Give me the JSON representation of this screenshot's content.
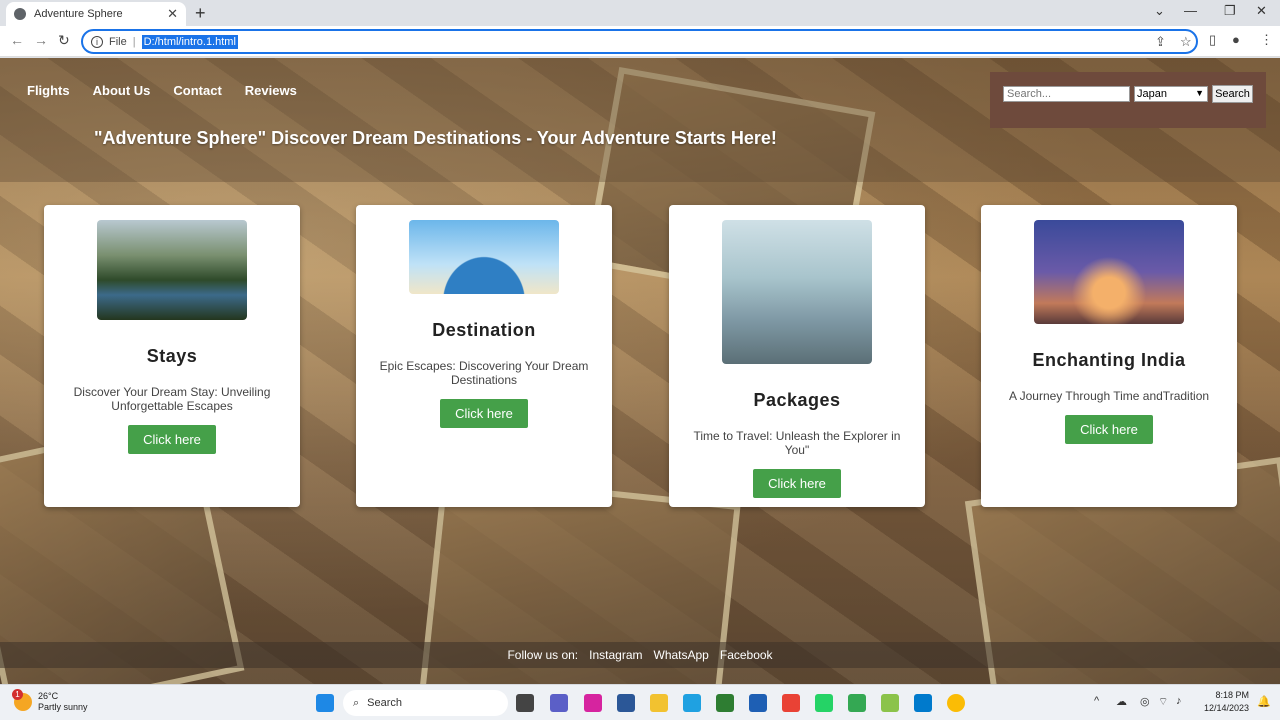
{
  "browser": {
    "tab_title": "Adventure Sphere",
    "new_tab": "+",
    "address_scheme": "File",
    "address_url": "D:/html/intro.1.html"
  },
  "page": {
    "nav": [
      "Flights",
      "About Us",
      "Contact",
      "Reviews"
    ],
    "search": {
      "placeholder": "Search...",
      "selected_country": "Japan",
      "button": "Search"
    },
    "headline": "\"Adventure Sphere\" Discover Dream Destinations - Your Adventure Starts Here!",
    "cards": [
      {
        "title": "Stays",
        "desc": "Discover Your Dream Stay: Unveiling Unforgettable Escapes",
        "button": "Click here"
      },
      {
        "title": "Destination",
        "desc": "Epic Escapes: Discovering Your Dream Destinations",
        "button": "Click here"
      },
      {
        "title": "Packages",
        "desc": "Time to Travel: Unleash the Explorer in You\"",
        "button": "Click here"
      },
      {
        "title": "Enchanting India",
        "desc": "A Journey Through Time andTradition",
        "button": "Click here"
      }
    ],
    "footer": {
      "label": "Follow us on:",
      "links": [
        "Instagram",
        "WhatsApp",
        "Facebook"
      ]
    }
  },
  "taskbar": {
    "weather_temp": "26°C",
    "weather_desc": "Partly sunny",
    "weather_badge": "1",
    "search_label": "Search",
    "time": "8:18 PM",
    "date": "12/14/2023"
  }
}
